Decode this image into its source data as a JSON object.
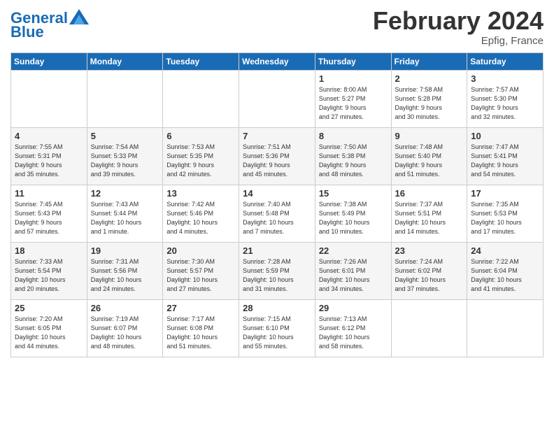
{
  "header": {
    "logo_general": "General",
    "logo_blue": "Blue",
    "month_year": "February 2024",
    "location": "Epfig, France"
  },
  "columns": [
    "Sunday",
    "Monday",
    "Tuesday",
    "Wednesday",
    "Thursday",
    "Friday",
    "Saturday"
  ],
  "weeks": [
    [
      {
        "day": "",
        "info": ""
      },
      {
        "day": "",
        "info": ""
      },
      {
        "day": "",
        "info": ""
      },
      {
        "day": "",
        "info": ""
      },
      {
        "day": "1",
        "info": "Sunrise: 8:00 AM\nSunset: 5:27 PM\nDaylight: 9 hours\nand 27 minutes."
      },
      {
        "day": "2",
        "info": "Sunrise: 7:58 AM\nSunset: 5:28 PM\nDaylight: 9 hours\nand 30 minutes."
      },
      {
        "day": "3",
        "info": "Sunrise: 7:57 AM\nSunset: 5:30 PM\nDaylight: 9 hours\nand 32 minutes."
      }
    ],
    [
      {
        "day": "4",
        "info": "Sunrise: 7:55 AM\nSunset: 5:31 PM\nDaylight: 9 hours\nand 35 minutes."
      },
      {
        "day": "5",
        "info": "Sunrise: 7:54 AM\nSunset: 5:33 PM\nDaylight: 9 hours\nand 39 minutes."
      },
      {
        "day": "6",
        "info": "Sunrise: 7:53 AM\nSunset: 5:35 PM\nDaylight: 9 hours\nand 42 minutes."
      },
      {
        "day": "7",
        "info": "Sunrise: 7:51 AM\nSunset: 5:36 PM\nDaylight: 9 hours\nand 45 minutes."
      },
      {
        "day": "8",
        "info": "Sunrise: 7:50 AM\nSunset: 5:38 PM\nDaylight: 9 hours\nand 48 minutes."
      },
      {
        "day": "9",
        "info": "Sunrise: 7:48 AM\nSunset: 5:40 PM\nDaylight: 9 hours\nand 51 minutes."
      },
      {
        "day": "10",
        "info": "Sunrise: 7:47 AM\nSunset: 5:41 PM\nDaylight: 9 hours\nand 54 minutes."
      }
    ],
    [
      {
        "day": "11",
        "info": "Sunrise: 7:45 AM\nSunset: 5:43 PM\nDaylight: 9 hours\nand 57 minutes."
      },
      {
        "day": "12",
        "info": "Sunrise: 7:43 AM\nSunset: 5:44 PM\nDaylight: 10 hours\nand 1 minute."
      },
      {
        "day": "13",
        "info": "Sunrise: 7:42 AM\nSunset: 5:46 PM\nDaylight: 10 hours\nand 4 minutes."
      },
      {
        "day": "14",
        "info": "Sunrise: 7:40 AM\nSunset: 5:48 PM\nDaylight: 10 hours\nand 7 minutes."
      },
      {
        "day": "15",
        "info": "Sunrise: 7:38 AM\nSunset: 5:49 PM\nDaylight: 10 hours\nand 10 minutes."
      },
      {
        "day": "16",
        "info": "Sunrise: 7:37 AM\nSunset: 5:51 PM\nDaylight: 10 hours\nand 14 minutes."
      },
      {
        "day": "17",
        "info": "Sunrise: 7:35 AM\nSunset: 5:53 PM\nDaylight: 10 hours\nand 17 minutes."
      }
    ],
    [
      {
        "day": "18",
        "info": "Sunrise: 7:33 AM\nSunset: 5:54 PM\nDaylight: 10 hours\nand 20 minutes."
      },
      {
        "day": "19",
        "info": "Sunrise: 7:31 AM\nSunset: 5:56 PM\nDaylight: 10 hours\nand 24 minutes."
      },
      {
        "day": "20",
        "info": "Sunrise: 7:30 AM\nSunset: 5:57 PM\nDaylight: 10 hours\nand 27 minutes."
      },
      {
        "day": "21",
        "info": "Sunrise: 7:28 AM\nSunset: 5:59 PM\nDaylight: 10 hours\nand 31 minutes."
      },
      {
        "day": "22",
        "info": "Sunrise: 7:26 AM\nSunset: 6:01 PM\nDaylight: 10 hours\nand 34 minutes."
      },
      {
        "day": "23",
        "info": "Sunrise: 7:24 AM\nSunset: 6:02 PM\nDaylight: 10 hours\nand 37 minutes."
      },
      {
        "day": "24",
        "info": "Sunrise: 7:22 AM\nSunset: 6:04 PM\nDaylight: 10 hours\nand 41 minutes."
      }
    ],
    [
      {
        "day": "25",
        "info": "Sunrise: 7:20 AM\nSunset: 6:05 PM\nDaylight: 10 hours\nand 44 minutes."
      },
      {
        "day": "26",
        "info": "Sunrise: 7:19 AM\nSunset: 6:07 PM\nDaylight: 10 hours\nand 48 minutes."
      },
      {
        "day": "27",
        "info": "Sunrise: 7:17 AM\nSunset: 6:08 PM\nDaylight: 10 hours\nand 51 minutes."
      },
      {
        "day": "28",
        "info": "Sunrise: 7:15 AM\nSunset: 6:10 PM\nDaylight: 10 hours\nand 55 minutes."
      },
      {
        "day": "29",
        "info": "Sunrise: 7:13 AM\nSunset: 6:12 PM\nDaylight: 10 hours\nand 58 minutes."
      },
      {
        "day": "",
        "info": ""
      },
      {
        "day": "",
        "info": ""
      }
    ]
  ]
}
